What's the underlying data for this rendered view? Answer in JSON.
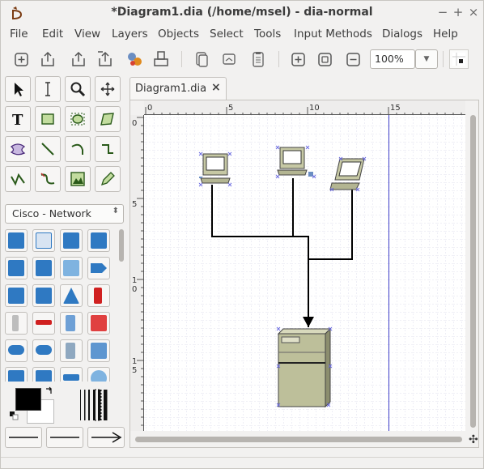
{
  "window": {
    "title": "*Diagram1.dia (/home/msel) - dia-normal",
    "controls": {
      "minimize": "−",
      "maximize": "+",
      "close": "×"
    }
  },
  "menu": [
    "File",
    "Edit",
    "View",
    "Layers",
    "Objects",
    "Select",
    "Tools",
    "Input Methods",
    "Dialogs",
    "Help"
  ],
  "toolbar": {
    "zoom_value": "100%"
  },
  "toolbox": {
    "sheet_name": "Cisco - Network"
  },
  "document_tab": {
    "label": "Diagram1.dia",
    "close_glyph": "×"
  },
  "rulers": {
    "horizontal_ticks": [
      "0",
      "5",
      "10",
      "15"
    ],
    "vertical_ticks": [
      "0",
      "5",
      "10",
      "15"
    ]
  },
  "diagram": {
    "objects": [
      "laptop-computer",
      "laptop-computer",
      "laptop-computer",
      "file-server"
    ],
    "connector_color": "#000000",
    "page_break_color": "#3c3cc8"
  },
  "colors": {
    "canvas_bg": "#ffffff",
    "grid": "#d6d6e8",
    "window_bg": "#f2f1f0"
  }
}
